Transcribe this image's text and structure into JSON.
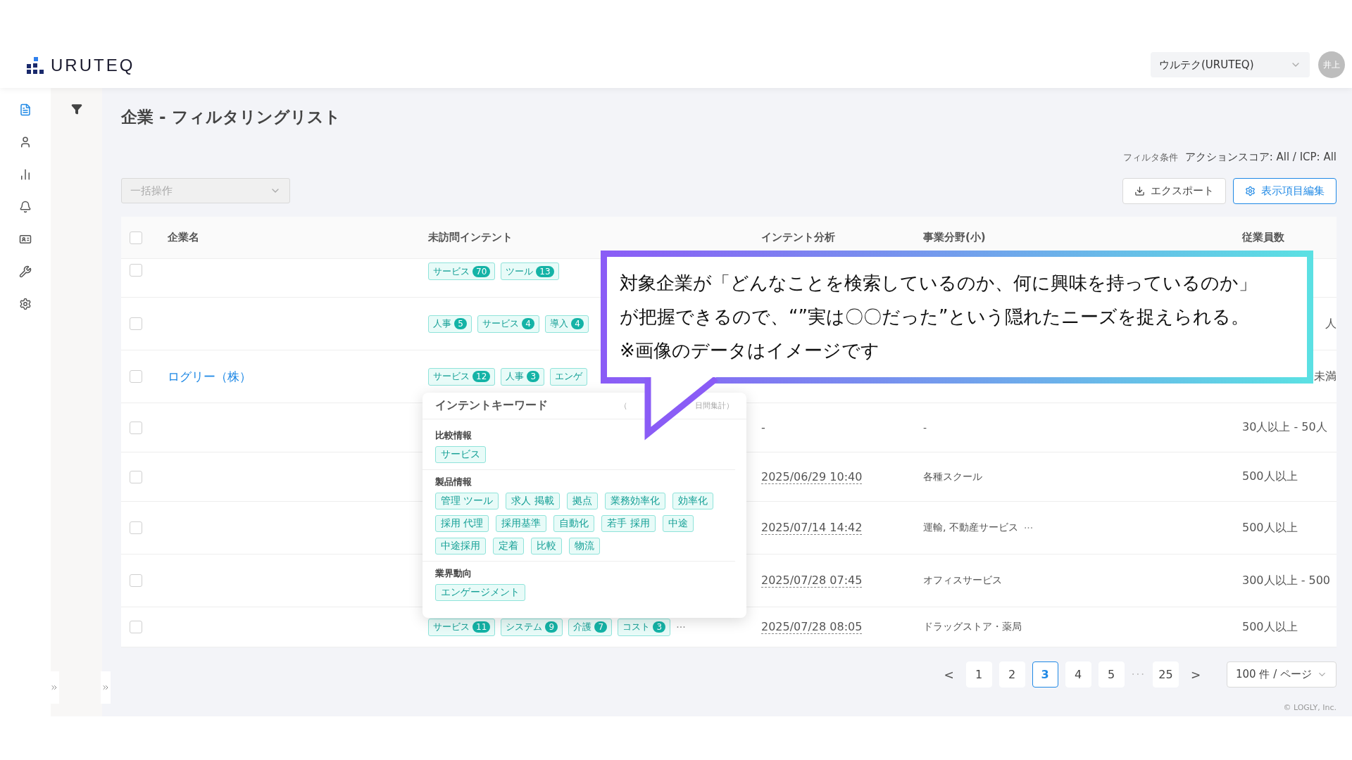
{
  "header": {
    "logo": "URUTEQ",
    "account_select": "ウルテク(URUTEQ)",
    "avatar": "井上"
  },
  "sidebar": {
    "items": [
      {
        "selected": true
      },
      {
        "selected": false
      },
      {
        "selected": false
      },
      {
        "selected": false
      },
      {
        "selected": false
      },
      {
        "selected": false
      },
      {
        "selected": false
      }
    ]
  },
  "page": {
    "title": "企業 - フィルタリングリスト",
    "filter_label": "フィルタ条件",
    "filter_value": "アクションスコア: All / ICP: All",
    "bulk_select": {
      "placeholder": "一括操作"
    },
    "export_button": "エクスポート",
    "columns_button": "表示項目編集"
  },
  "table": {
    "header_checked": false,
    "columns": [
      "企業名",
      "未訪問インテント",
      "インテント分析",
      "事業分野(小)",
      "従業員数"
    ],
    "rows": [
      {
        "checked": false,
        "name": "",
        "tags": [
          {
            "label": "サービス",
            "count": "70"
          },
          {
            "label": "ツール",
            "count": "13"
          }
        ],
        "analysis": "",
        "business": "",
        "employees": ""
      },
      {
        "checked": false,
        "name": "",
        "tags": [
          {
            "label": "人事",
            "count": "5"
          },
          {
            "label": "サービス",
            "count": "4"
          },
          {
            "label": "導入",
            "count": "4"
          }
        ],
        "analysis": "",
        "business": "",
        "employees": "人"
      },
      {
        "checked": false,
        "name": "ログリー（株）",
        "tags": [
          {
            "label": "サービス",
            "count": "12"
          },
          {
            "label": "人事",
            "count": "3"
          },
          {
            "label": "エンゲ"
          }
        ],
        "analysis": "",
        "business": "",
        "employees": "未満"
      },
      {
        "checked": false,
        "name": "",
        "tags": [],
        "analysis": "-",
        "business": "-",
        "employees": "30人以上 - 50人"
      },
      {
        "checked": false,
        "name": "",
        "tags": [],
        "analysis": "2025/06/29 10:40",
        "business": "各種スクール",
        "employees": "500人以上"
      },
      {
        "checked": false,
        "name": "",
        "tags": [],
        "analysis": "2025/07/14 14:42",
        "business": "運輸, 不動産サービス",
        "business_more": "···",
        "employees": "500人以上"
      },
      {
        "checked": false,
        "name": "",
        "tags": [],
        "analysis": "2025/07/28 07:45",
        "business": "オフィスサービス",
        "employees": "300人以上 - 500"
      },
      {
        "checked": false,
        "name": "",
        "tags": [
          {
            "label": "サービス",
            "count": "11"
          },
          {
            "label": "システム",
            "count": "9"
          },
          {
            "label": "介護",
            "count": "7"
          },
          {
            "label": "コスト",
            "count": "3"
          }
        ],
        "tags_more": "···",
        "analysis": "2025/07/28 08:05",
        "business": "ドラッグストア・薬局",
        "employees": "500人以上"
      }
    ]
  },
  "popover": {
    "title": "インテントキーワード",
    "note_start": "（",
    "note_end": "日間集計）",
    "sections": [
      {
        "heading": "比較情報",
        "keywords": [
          "サービス"
        ]
      },
      {
        "heading": "製品情報",
        "keywords": [
          "管理 ツール",
          "求人 掲載",
          "拠点",
          "業務効率化",
          "効率化",
          "採用 代理",
          "採用基準",
          "自動化",
          "若手 採用",
          "中途",
          "中途採用",
          "定着",
          "比較",
          "物流"
        ]
      },
      {
        "heading": "業界動向",
        "keywords": [
          "エンゲージメント"
        ]
      }
    ]
  },
  "pagination": {
    "prev": "<",
    "pages": [
      {
        "label": "1",
        "selected": false
      },
      {
        "label": "2",
        "selected": false
      },
      {
        "label": "3",
        "selected": true
      },
      {
        "label": "4",
        "selected": false
      },
      {
        "label": "5",
        "selected": false
      }
    ],
    "ellipsis": "···",
    "last": {
      "label": "25",
      "selected": false
    },
    "next": ">",
    "page_size": "100 件 / ページ"
  },
  "footer": {
    "copyright": "© LOGLY, Inc."
  },
  "callout": {
    "lines": [
      "対象企業が「どんなことを検索しているのか、何に興味を持っているのか」",
      "が把握できるので、“”実は〇〇だった”という隠れたニーズを捉えられる。",
      "※画像のデータはイメージです"
    ]
  }
}
